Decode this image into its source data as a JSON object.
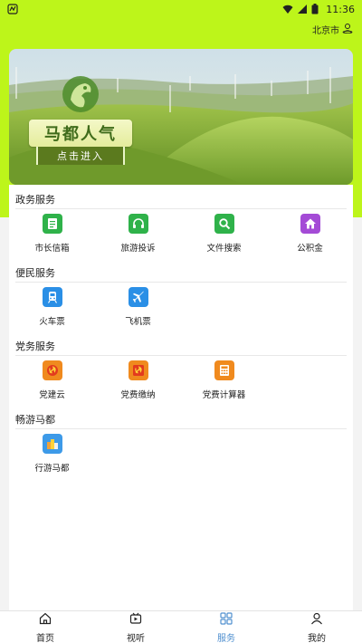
{
  "status_bar": {
    "time": "11:36",
    "left_icon": "app-notification-icon",
    "right_icons": [
      "wifi-icon",
      "signal-icon",
      "battery-icon"
    ]
  },
  "location": {
    "city": "北京市",
    "icon": "location-person-icon"
  },
  "banner": {
    "title": "马都人气",
    "subtitle": "点击进入",
    "logo": "horse-emblem-icon"
  },
  "sections": [
    {
      "title": "政务服务",
      "items": [
        {
          "label": "市长信箱",
          "icon": "mailbox-icon",
          "color": "#2fb24a"
        },
        {
          "label": "旅游投诉",
          "icon": "headset-icon",
          "color": "#2fb24a"
        },
        {
          "label": "文件搜索",
          "icon": "search-icon",
          "color": "#2fb24a"
        },
        {
          "label": "公积金",
          "icon": "home-icon",
          "color": "#a44bd6"
        }
      ]
    },
    {
      "title": "便民服务",
      "items": [
        {
          "label": "火车票",
          "icon": "train-icon",
          "color": "#2a8fe6"
        },
        {
          "label": "飞机票",
          "icon": "airplane-icon",
          "color": "#2a8fe6"
        }
      ]
    },
    {
      "title": "党务服务",
      "items": [
        {
          "label": "党建云",
          "icon": "party-emblem-icon",
          "color": "#f08a1e"
        },
        {
          "label": "党费缴纳",
          "icon": "party-emblem-icon",
          "color": "#f08a1e"
        },
        {
          "label": "党费计算器",
          "icon": "calculator-icon",
          "color": "#f08a1e"
        }
      ]
    },
    {
      "title": "畅游马都",
      "items": [
        {
          "label": "行游马都",
          "icon": "travel-guide-icon",
          "color": "#3d9ae8"
        }
      ]
    }
  ],
  "bottom_nav": [
    {
      "label": "首页",
      "icon": "home-outline-icon",
      "active": false
    },
    {
      "label": "视听",
      "icon": "video-icon",
      "active": false
    },
    {
      "label": "服务",
      "icon": "grid-icon",
      "active": true
    },
    {
      "label": "我的",
      "icon": "person-icon",
      "active": false
    }
  ],
  "colors": {
    "header_green": "#bdf51a",
    "active_tab": "#4f8fcf"
  }
}
